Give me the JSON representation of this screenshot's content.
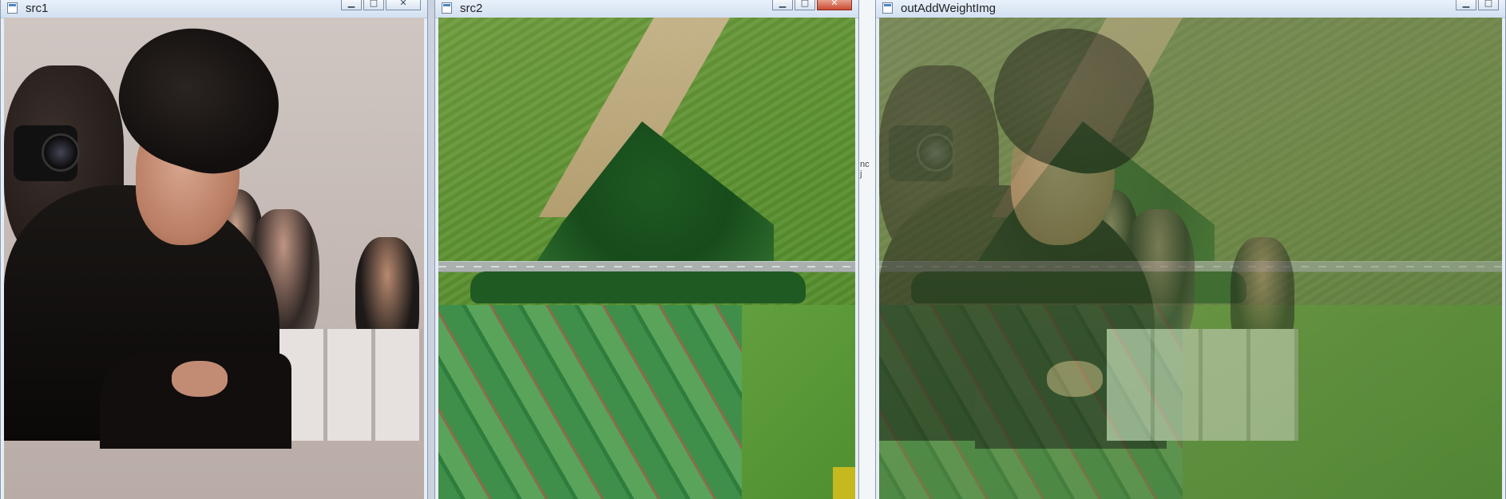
{
  "windows": [
    {
      "title": "src1",
      "buttons": [
        "minimize",
        "maximize",
        "close"
      ]
    },
    {
      "title": "src2",
      "buttons": [
        "minimize",
        "maximize",
        "close"
      ]
    },
    {
      "title": "outAddWeightImg",
      "buttons": [
        "minimize",
        "maximize"
      ]
    }
  ],
  "background_snippet": {
    "line1": "nc",
    "line2": "j"
  },
  "colors": {
    "titlebar_top": "#e9f1fb",
    "titlebar_bottom": "#d2e0f1",
    "close_red": "#c94a30"
  },
  "icons": {
    "minimize": "minimize-icon",
    "maximize": "maximize-icon",
    "close": "close-icon"
  }
}
